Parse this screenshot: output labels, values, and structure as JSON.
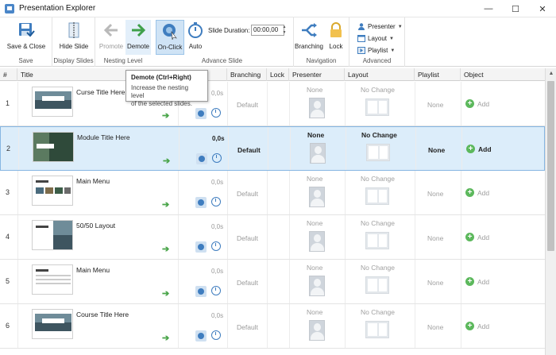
{
  "window": {
    "title": "Presentation Explorer",
    "minimize": "—",
    "maximize": "☐",
    "close": "✕"
  },
  "ribbon": {
    "groups": {
      "save": "Save",
      "display": "Display Slides",
      "nesting": "Nesting Level",
      "advance": "Advance Slide",
      "navigation": "Navigation",
      "advanced": "Advanced"
    },
    "buttons": {
      "save_close": "Save & Close",
      "hide_slide": "Hide Slide",
      "promote": "Promote",
      "demote": "Demote",
      "on_click": "On-Click",
      "auto": "Auto",
      "branching": "Branching",
      "lock": "Lock",
      "presenter": "Presenter",
      "layout": "Layout",
      "playlist": "Playlist"
    },
    "slide_duration": {
      "label": "Slide Duration:",
      "value": "00:00,00"
    }
  },
  "tooltip": {
    "title": "Demote (Ctrl+Right)",
    "body_line1": "Increase the nesting level",
    "body_line2": "of the selected slides."
  },
  "table": {
    "headers": {
      "num": "#",
      "title": "Title",
      "branching": "Branching",
      "lock": "Lock",
      "presenter": "Presenter",
      "layout": "Layout",
      "playlist": "Playlist",
      "object": "Object"
    },
    "rows": [
      {
        "num": "1",
        "title": "Curse Title Here",
        "duration": "0,0s",
        "branching": "Default",
        "presenter": "None",
        "layout": "No Change",
        "playlist": "None",
        "object": "Add"
      },
      {
        "num": "2",
        "title": "Module Title Here",
        "duration": "0,0s",
        "branching": "Default",
        "presenter": "None",
        "layout": "No Change",
        "playlist": "None",
        "object": "Add"
      },
      {
        "num": "3",
        "title": "Main Menu",
        "duration": "0,0s",
        "branching": "Default",
        "presenter": "None",
        "layout": "No Change",
        "playlist": "None",
        "object": "Add"
      },
      {
        "num": "4",
        "title": "50/50 Layout",
        "duration": "0,0s",
        "branching": "Default",
        "presenter": "None",
        "layout": "No Change",
        "playlist": "None",
        "object": "Add"
      },
      {
        "num": "5",
        "title": "Main Menu",
        "duration": "0,0s",
        "branching": "Default",
        "presenter": "None",
        "layout": "No Change",
        "playlist": "None",
        "object": "Add"
      },
      {
        "num": "6",
        "title": "Course Title Here",
        "duration": "0,0s",
        "branching": "Default",
        "presenter": "None",
        "layout": "No Change",
        "playlist": "None",
        "object": "Add"
      }
    ],
    "selected_row": 2
  },
  "colors": {
    "accent": "#3f7dbf",
    "selection": "#dcedfa",
    "add_green": "#5cb85c",
    "arrow_green": "#4aa54a"
  }
}
